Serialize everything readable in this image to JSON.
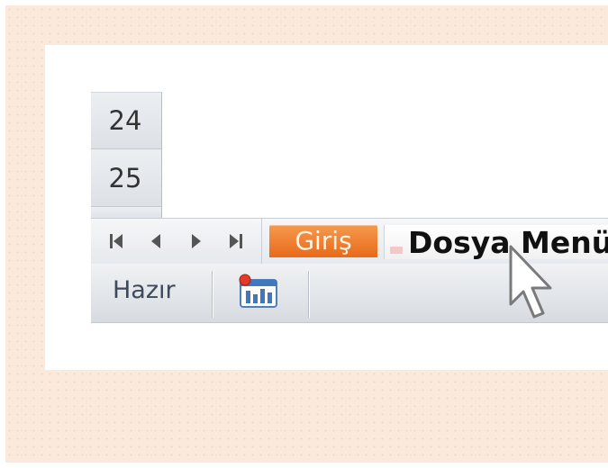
{
  "rows": {
    "row_24": "24",
    "row_25": "25"
  },
  "sheet_nav": {
    "first": "first-sheet-icon",
    "prev": "previous-sheet-icon",
    "next": "next-sheet-icon",
    "last": "last-sheet-icon"
  },
  "tabs": [
    {
      "label": "Giriş",
      "active": true,
      "color": "#e8711c"
    },
    {
      "label": "Dosya Menü",
      "active": false
    }
  ],
  "status_bar": {
    "ready_text": "Hazır",
    "macro_icon": "record-macro-icon"
  },
  "colors": {
    "accent_tab": "#e8711c",
    "page_bg": "#fbe9dc"
  }
}
